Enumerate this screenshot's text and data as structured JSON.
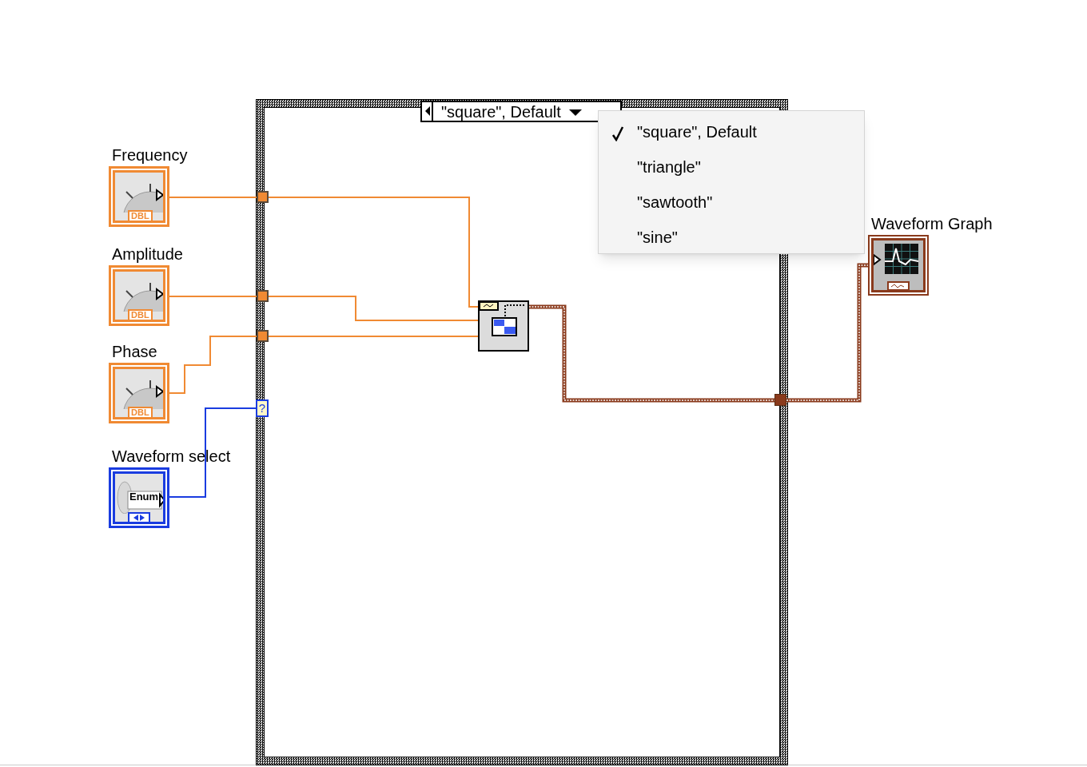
{
  "controls": [
    {
      "label": "Frequency",
      "kind": "numeric",
      "type_label": "DBL"
    },
    {
      "label": "Amplitude",
      "kind": "numeric",
      "type_label": "DBL"
    },
    {
      "label": "Phase",
      "kind": "numeric",
      "type_label": "DBL"
    },
    {
      "label": "Waveform select",
      "kind": "enum",
      "type_label": "Enum"
    }
  ],
  "case_structure": {
    "selector_value": "\"square\", Default",
    "selector_tunnel": "?",
    "menu": [
      {
        "label": "\"square\", Default",
        "selected": true
      },
      {
        "label": "\"triangle\"",
        "selected": false
      },
      {
        "label": "\"sawtooth\"",
        "selected": false
      },
      {
        "label": "\"sine\"",
        "selected": false
      }
    ]
  },
  "indicator": {
    "label": "Waveform Graph"
  }
}
